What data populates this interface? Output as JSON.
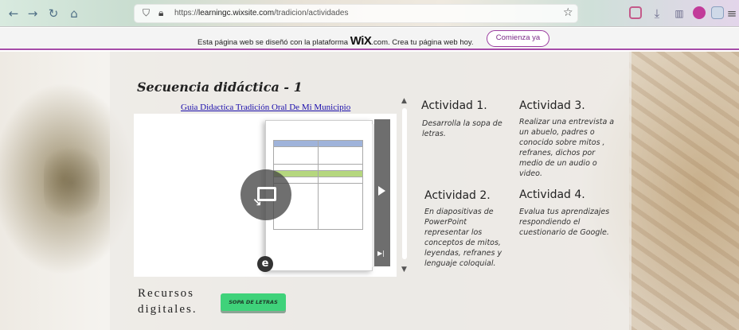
{
  "browser": {
    "url_scheme": "https://",
    "url_domain": "learningc.wixsite.com",
    "url_path": "/tradicion/actividades",
    "icons": [
      "back-icon",
      "forward-icon",
      "reload-icon",
      "home-icon",
      "shield-icon",
      "lock-icon",
      "star-icon",
      "pocket-icon",
      "download-icon",
      "library-icon",
      "account-icon",
      "extensions-icon",
      "menu-icon"
    ]
  },
  "wix_banner": {
    "message_before": "Esta página web se diseñó con la plataforma",
    "brand": "WiX",
    "message_after": ".com. Crea tu página web hoy.",
    "cta_label": "Comienza ya",
    "accent": "#a64ca8"
  },
  "main": {
    "heading": "Secuencia didáctica - 1",
    "document_link": "Guia Didactica Tradición Oral De Mi Municipio",
    "viewer": {
      "logo_letter": "e",
      "icons": [
        "fullscreen-icon",
        "next-page-icon",
        "last-page-icon"
      ]
    }
  },
  "activities": [
    {
      "title": "Actividad 1.",
      "text": "Desarrolla la sopa de letras."
    },
    {
      "title": "Actividad 2.",
      "text": "En diapositivas de PowerPoint representar los conceptos de mitos, leyendas, refranes y lenguaje coloquial."
    },
    {
      "title": "Actividad 3.",
      "text": "Realizar una entrevista a un abuelo, padres o conocido sobre mitos , refranes, dichos por medio de un audio o video."
    },
    {
      "title": "Actividad 4.",
      "text": "Evalua tus aprendizajes respondiendo el cuestionario de Google."
    }
  ],
  "resources": {
    "label_line1": "Recursos",
    "label_line2": "digitales.",
    "button_label": "SOPA DE LETRAS",
    "button_color": "#3fd27a"
  }
}
